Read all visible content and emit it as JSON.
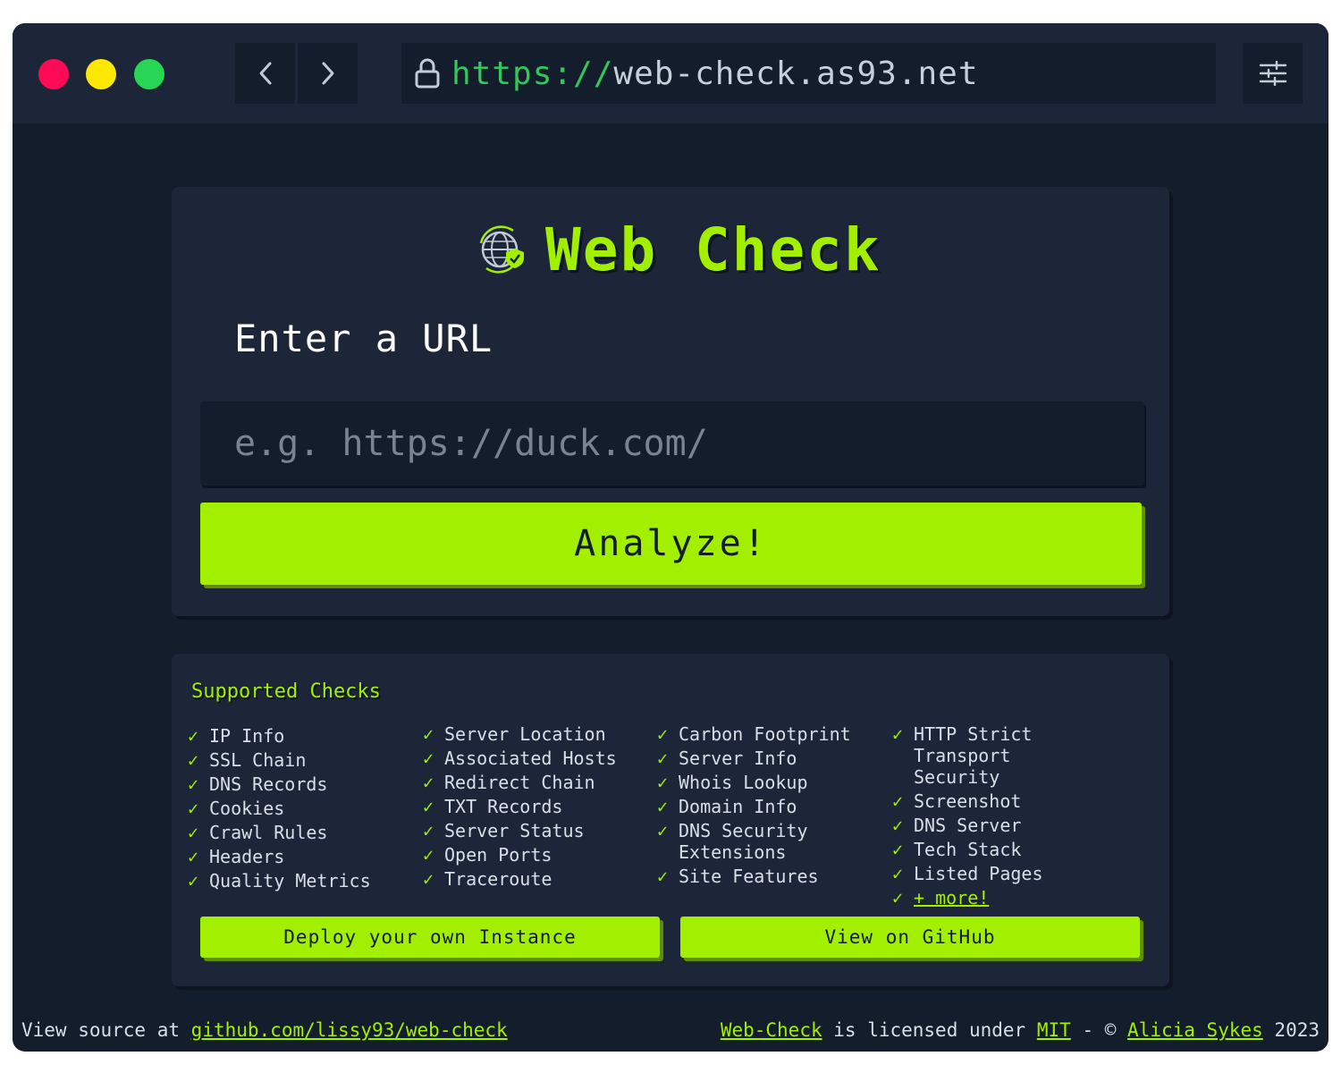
{
  "browser": {
    "url_scheme": "https://",
    "url_host": "web-check.as93.net"
  },
  "brand": {
    "title": "Web Check",
    "accent_color": "#a2ef00"
  },
  "form": {
    "label": "Enter a URL",
    "placeholder": "e.g. https://duck.com/",
    "value": "",
    "submit_label": "Analyze!"
  },
  "checks": {
    "title": "Supported Checks",
    "tick": "✓",
    "columns": [
      [
        "IP Info",
        "SSL Chain",
        "DNS Records",
        "Cookies",
        "Crawl Rules",
        "Headers",
        "Quality Metrics"
      ],
      [
        "Server Location",
        "Associated Hosts",
        "Redirect Chain",
        "TXT Records",
        "Server Status",
        "Open Ports",
        "Traceroute"
      ],
      [
        "Carbon Footprint",
        "Server Info",
        "Whois Lookup",
        "Domain Info",
        "DNS Security Extensions",
        "Site Features"
      ],
      [
        "HTTP Strict Transport Security",
        "Screenshot",
        "DNS Server",
        "Tech Stack",
        "Listed Pages"
      ]
    ],
    "more_link": "+ more!",
    "deploy_label": "Deploy your own Instance",
    "github_label": "View on GitHub"
  },
  "footer": {
    "source_prefix": "View source at",
    "source_link": "github.com/lissy93/web-check",
    "project_link": "Web-Check",
    "license_text": "is licensed under",
    "license_link": "MIT",
    "separator": "- ©",
    "author_link": "Alicia Sykes",
    "year": "2023"
  }
}
